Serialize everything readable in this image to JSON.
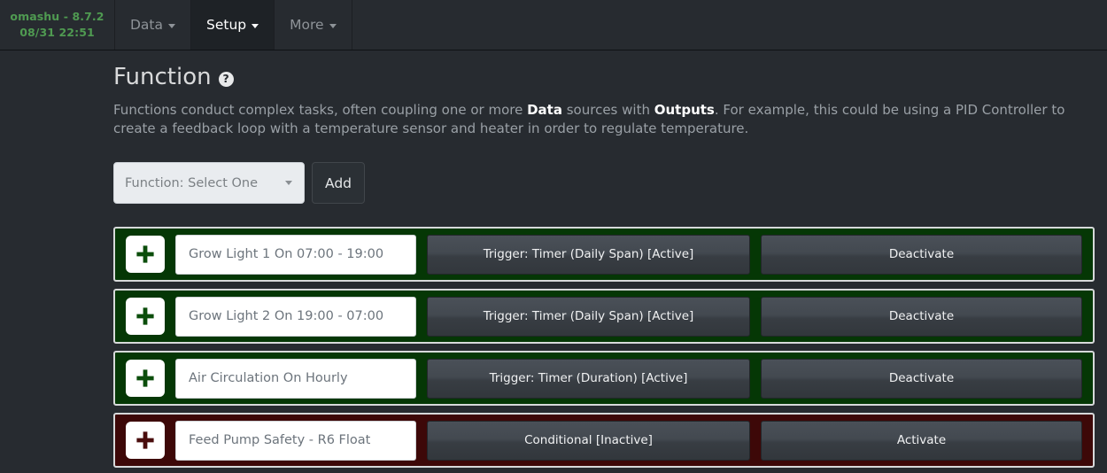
{
  "navbar": {
    "brand_line1": "omashu - 8.7.2",
    "brand_line2": "08/31 22:51",
    "items": [
      {
        "label": "Data",
        "active": false
      },
      {
        "label": "Setup",
        "active": true
      },
      {
        "label": "More",
        "active": false
      }
    ]
  },
  "page": {
    "title": "Function",
    "help_icon": "?",
    "description_part1": "Functions conduct complex tasks, often coupling one or more ",
    "description_strong1": "Data",
    "description_part2": " sources with ",
    "description_strong2": "Outputs",
    "description_part3": ". For example, this could be using a PID Controller to create a feedback loop with a temperature sensor and heater in order to regulate temperature."
  },
  "addbar": {
    "select_value": "Function: Select One",
    "add_label": "Add"
  },
  "functions": [
    {
      "name": "Grow Light 1 On 07:00 - 19:00",
      "condition": "Trigger: Timer (Daily Span) [Active]",
      "toggle": "Deactivate",
      "state": "active",
      "plus_icon": "plus-icon"
    },
    {
      "name": "Grow Light 2 On 19:00 - 07:00",
      "condition": "Trigger: Timer (Daily Span) [Active]",
      "toggle": "Deactivate",
      "state": "active",
      "plus_icon": "plus-icon"
    },
    {
      "name": "Air Circulation On Hourly",
      "condition": "Trigger: Timer (Duration) [Active]",
      "toggle": "Deactivate",
      "state": "active",
      "plus_icon": "plus-icon"
    },
    {
      "name": "Feed Pump Safety - R6 Float",
      "condition": "Conditional [Inactive]",
      "toggle": "Activate",
      "state": "inactive",
      "plus_icon": "plus-icon"
    }
  ],
  "colors": {
    "background": "#272b30",
    "brand_green": "#4f9a51",
    "row_active_fill": "#053705",
    "row_inactive_fill": "#3d0808",
    "row_border": "#d7d9da",
    "button_text": "#f0f1f2"
  }
}
